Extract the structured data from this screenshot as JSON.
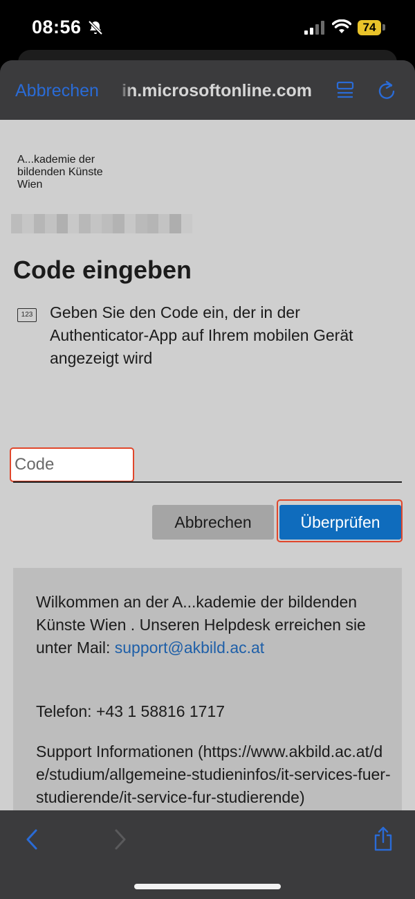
{
  "status_bar": {
    "time": "08:56",
    "battery": "74"
  },
  "browser": {
    "cancel_label": "Abbrechen",
    "url": "in.microsoftonline.com"
  },
  "page": {
    "logo_lines": [
      "A...kademie der",
      "bildenden Künste",
      "Wien"
    ],
    "title": "Code eingeben",
    "icon_label": "123",
    "instruction": "Geben Sie den Code ein, der in der Authenticator-App auf Ihrem mobilen Gerät angezeigt wird",
    "code_placeholder": "Code",
    "cancel_button": "Abbrechen",
    "verify_button": "Überprüfen",
    "info": {
      "welcome": "Wilkommen an der A...kademie der bildenden Künste Wien . Unseren Helpdesk erreichen sie unter Mail:",
      "email": "support@akbild.ac.at",
      "phone": "Telefon: +43 1 58816 1717",
      "support_title": "Support Informationen",
      "support_url": "(https://www.akbild.ac.at/de/studium/allgemeine-studieninfos/it-services-fuer-studierende/it-service-fur-studierende)"
    }
  },
  "colors": {
    "accent": "#0f6cbd",
    "link": "#2a6bd6",
    "highlight": "#e0462b",
    "battery": "#e9c32a"
  }
}
